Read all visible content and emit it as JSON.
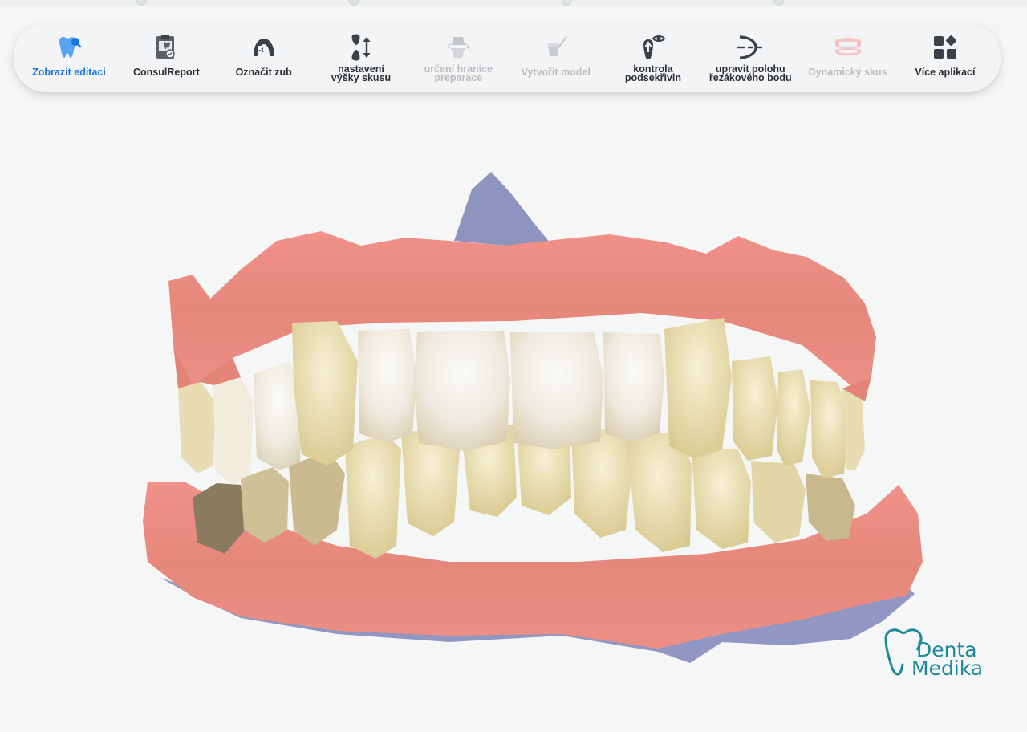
{
  "toolbar": {
    "items": [
      {
        "label": "Zobrazit editaci",
        "icon": "tooth-search-icon",
        "state": "active"
      },
      {
        "label": "ConsulReport",
        "icon": "report-icon",
        "state": "normal"
      },
      {
        "label": "Označit zub",
        "icon": "mark-tooth-icon",
        "state": "normal"
      },
      {
        "label_line1": "nastavení",
        "label_line2": "výšky skusu",
        "icon": "bite-height-icon",
        "state": "normal"
      },
      {
        "label_line1": "určení hranice",
        "label_line2": "preparace",
        "icon": "margin-line-icon",
        "state": "disabled"
      },
      {
        "label": "Vytvořit model",
        "icon": "create-model-icon",
        "state": "disabled"
      },
      {
        "label_line1": "kontrola",
        "label_line2": "podsekřivin",
        "icon": "undercut-check-icon",
        "state": "normal"
      },
      {
        "label_line1": "upravit polohu",
        "label_line2": "řezákového bodu",
        "icon": "incisal-point-icon",
        "state": "normal"
      },
      {
        "label": "Dynamický skus",
        "icon": "dynamic-bite-icon",
        "state": "disabled"
      },
      {
        "label": "Více aplikací",
        "icon": "more-apps-icon",
        "state": "normal"
      }
    ]
  },
  "viewport": {
    "content": "3D intraoral scan model"
  },
  "logo": {
    "line1": "Denta",
    "line2": "Medika"
  },
  "colors": {
    "accent": "#1a73e8",
    "icon_dark": "#3b4148",
    "disabled": "#b9bcbf",
    "logo": "#1c8a97",
    "gum": "#e98a7c",
    "tooth": "#f2ead2",
    "scan_base": "#8f94bf"
  }
}
